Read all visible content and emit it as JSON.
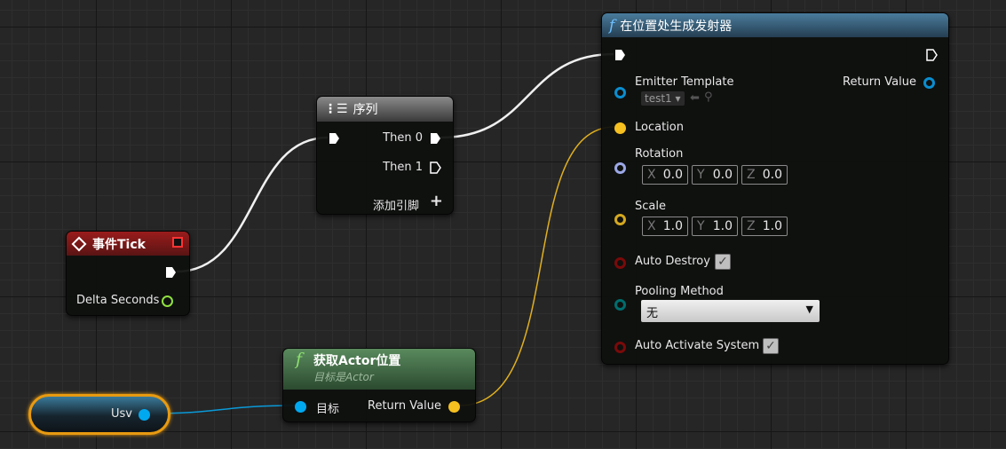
{
  "event_tick": {
    "title": "事件Tick",
    "pins": {
      "delta": "Delta Seconds"
    }
  },
  "sequence": {
    "title": "序列",
    "then0": "Then 0",
    "then1": "Then 1",
    "add_pin": "添加引脚"
  },
  "spawn": {
    "title": "在位置处生成发射器",
    "emitter_template": "Emitter Template",
    "emitter_value": "test1",
    "return_value": "Return Value",
    "location": "Location",
    "rotation": "Rotation",
    "rotation_xyz": [
      "0.0",
      "0.0",
      "0.0"
    ],
    "scale": "Scale",
    "scale_xyz": [
      "1.0",
      "1.0",
      "1.0"
    ],
    "auto_destroy": "Auto Destroy",
    "auto_destroy_checked": true,
    "pooling_method": "Pooling Method",
    "pooling_value": "无",
    "auto_activate": "Auto Activate System",
    "auto_activate_checked": true
  },
  "get_location": {
    "title": "获取Actor位置",
    "subtitle": "目标是Actor",
    "target": "目标",
    "return_value": "Return Value"
  },
  "variable": {
    "name": "Usv"
  },
  "axes": [
    "X",
    "Y",
    "Z"
  ],
  "colors": {
    "exec": "#ffffff",
    "object": "#00a8f0",
    "vector": "#f5c020",
    "rotator": "#9ca8e6",
    "bool": "#8c0000",
    "float": "#90e040",
    "byte": "#006d6d",
    "event_header": "#8a1a1a",
    "function_header": "#3c6c8c",
    "pure_header": "#4c7050"
  }
}
